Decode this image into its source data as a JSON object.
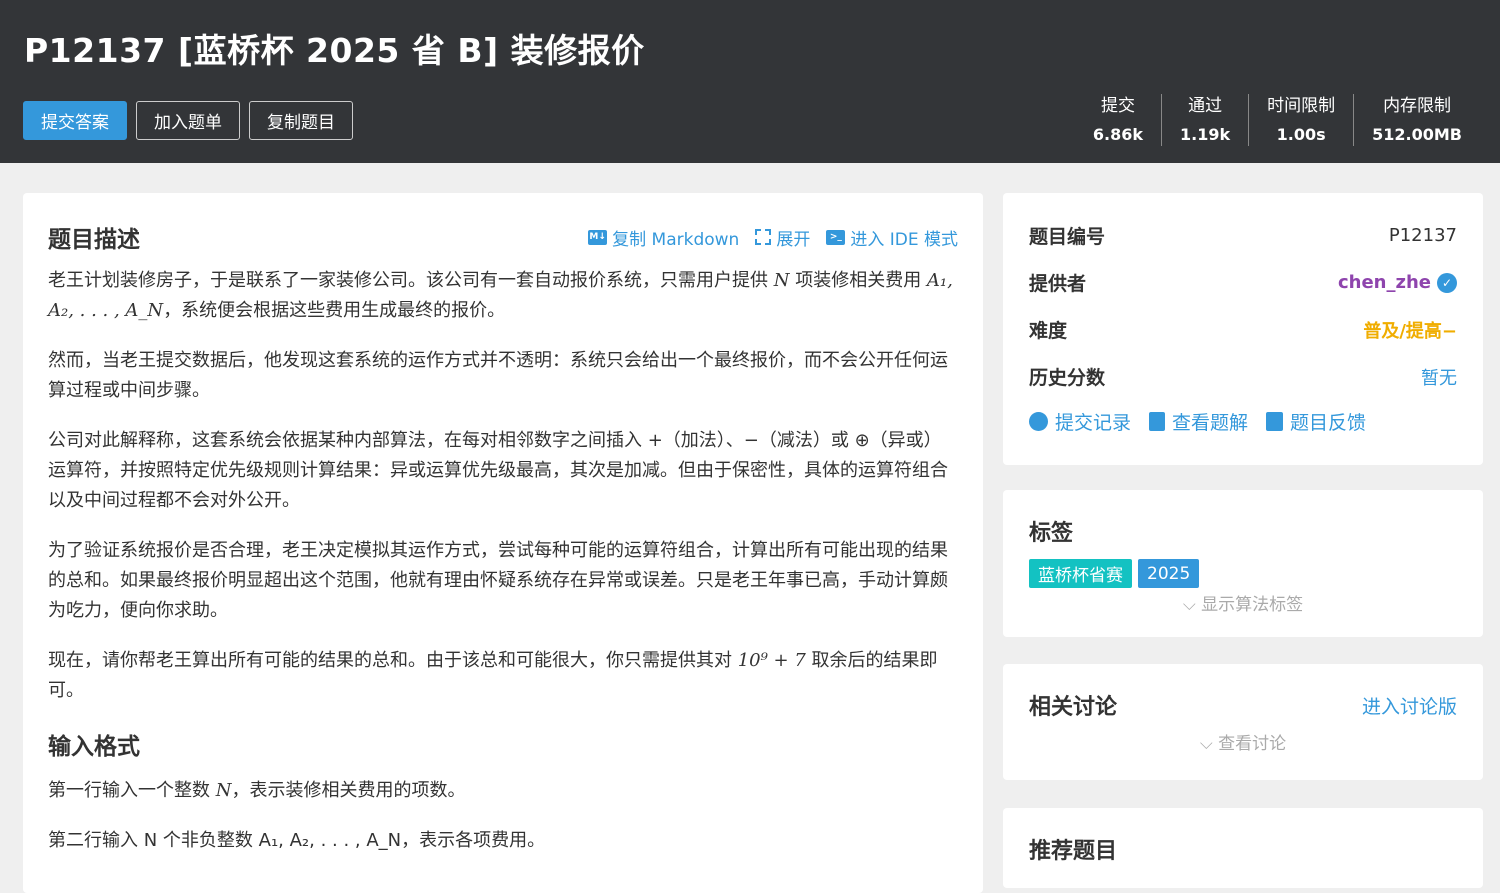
{
  "header": {
    "title": "P12137 [蓝桥杯 2025 省 B] 装修报价",
    "buttons": {
      "submit": "提交答案",
      "add_list": "加入题单",
      "copy": "复制题目"
    },
    "stats": {
      "submissions_label": "提交",
      "submissions_value": "6.86k",
      "accepted_label": "通过",
      "accepted_value": "1.19k",
      "time_label": "时间限制",
      "time_value": "1.00s",
      "memory_label": "内存限制",
      "memory_value": "512.00MB"
    }
  },
  "main": {
    "desc_title": "题目描述",
    "tools": {
      "copy_markdown": "复制 Markdown",
      "expand": "展开",
      "ide_mode": "进入 IDE 模式"
    },
    "p1": {
      "a": "老王计划装修房子，于是联系了一家装修公司。该公司有一套自动报价系统，只需用户提供 ",
      "n": "N",
      "b": " 项装修相关费用 ",
      "seq": "A₁, A₂, . . . , A_N",
      "c": "，系统便会根据这些费用生成最终的报价。"
    },
    "p2": "然而，当老王提交数据后，他发现这套系统的运作方式并不透明：系统只会给出一个最终报价，而不会公开任何运算过程或中间步骤。",
    "p3": "公司对此解释称，这套系统会依据某种内部算法，在每对相邻数字之间插入 +（加法）、−（减法）或 ⊕（异或）运算符，并按照特定优先级规则计算结果：异或运算优先级最高，其次是加减。但由于保密性，具体的运算符组合以及中间过程都不会对外公开。",
    "p4": "为了验证系统报价是否合理，老王决定模拟其运作方式，尝试每种可能的运算符组合，计算出所有可能出现的结果的总和。如果最终报价明显超出这个范围，他就有理由怀疑系统存在异常或误差。只是老王年事已高，手动计算颇为吃力，便向你求助。",
    "p5": {
      "a": "现在，请你帮老王算出所有可能的结果的总和。由于该总和可能很大，你只需提供其对 ",
      "mod": "10⁹ + 7",
      "b": " 取余后的结果即可。"
    },
    "input_title": "输入格式",
    "p6": {
      "a": "第一行输入一个整数 ",
      "n": "N",
      "b": "，表示装修相关费用的项数。"
    },
    "p7": "第二行输入 N 个非负整数 A₁, A₂, . . . , A_N，表示各项费用。"
  },
  "info": {
    "id_label": "题目编号",
    "id_value": "P12137",
    "provider_label": "提供者",
    "provider_value": "chen_zhe",
    "difficulty_label": "难度",
    "difficulty_value": "普及/提高−",
    "history_label": "历史分数",
    "history_value": "暂无",
    "links": {
      "records": "提交记录",
      "solutions": "查看题解",
      "feedback": "题目反馈"
    }
  },
  "tags_card": {
    "title": "标签",
    "tags": [
      "蓝桥杯省赛",
      "2025"
    ],
    "tag_colors": [
      "#13c2c2",
      "#3498db"
    ],
    "toggle": "显示算法标签"
  },
  "discussion": {
    "title": "相关讨论",
    "link": "进入讨论版",
    "toggle": "查看讨论"
  },
  "recommend": {
    "title": "推荐题目"
  }
}
